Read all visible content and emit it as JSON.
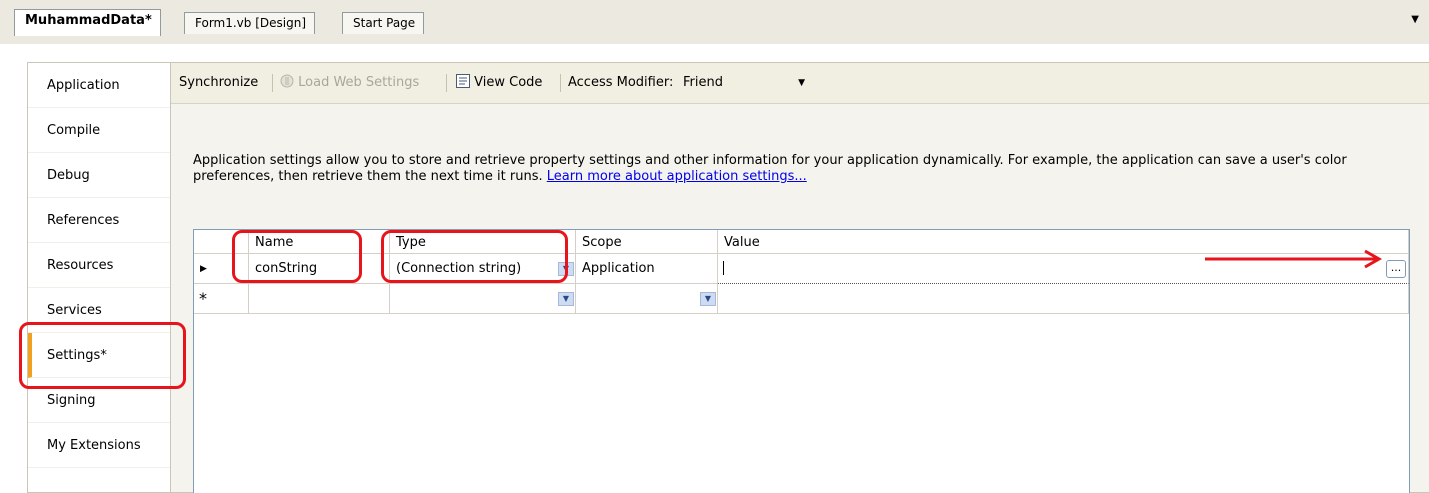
{
  "tabs": [
    {
      "label": "MuhammadData*",
      "active": true
    },
    {
      "label": "Form1.vb [Design]",
      "active": false
    },
    {
      "label": "Start Page",
      "active": false
    }
  ],
  "nav": {
    "items": [
      {
        "label": "Application"
      },
      {
        "label": "Compile"
      },
      {
        "label": "Debug"
      },
      {
        "label": "References"
      },
      {
        "label": "Resources"
      },
      {
        "label": "Services"
      },
      {
        "label": "Settings*",
        "selected": true
      },
      {
        "label": "Signing"
      },
      {
        "label": "My Extensions"
      }
    ]
  },
  "toolbar": {
    "synchronize": "Synchronize",
    "load_web_settings": "Load Web Settings",
    "view_code": "View Code",
    "access_modifier_label": "Access Modifier:",
    "access_modifier_value": "Friend"
  },
  "description": {
    "text": "Application settings allow you to store and retrieve property settings and other information for your application dynamically. For example, the application can save a user's color preferences, then retrieve them the next time it runs.",
    "link": "Learn more about application settings..."
  },
  "grid": {
    "columns": [
      "Name",
      "Type",
      "Scope",
      "Value"
    ],
    "rows": [
      {
        "name": "conString",
        "type": "(Connection string)",
        "scope": "Application",
        "value": ""
      }
    ],
    "new_row_marker": "*",
    "ellipsis": "..."
  },
  "colors": {
    "highlight": "#e8141b",
    "selected_tab_accent": "#f2a020",
    "link": "#0000ee"
  }
}
